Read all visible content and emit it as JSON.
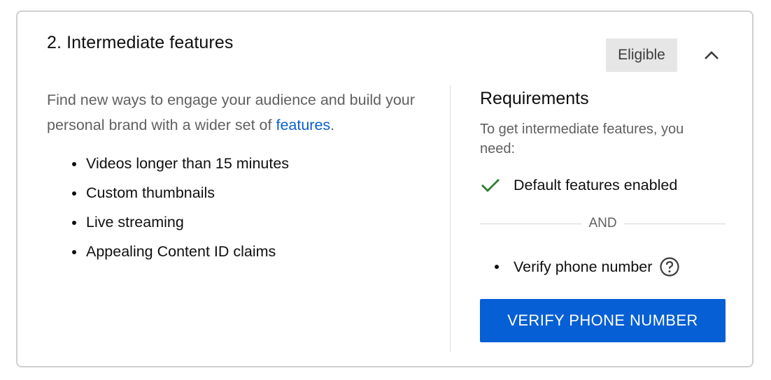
{
  "card": {
    "title": "2. Intermediate features",
    "status_badge": "Eligible",
    "collapse_icon": "chevron-up-icon"
  },
  "left": {
    "description_prefix": "Find new ways to engage your audience and build your personal brand with a wider set of ",
    "description_link": "features",
    "description_suffix": ".",
    "features": [
      "Videos longer than 15 minutes",
      "Custom thumbnails",
      "Live streaming",
      "Appealing Content ID claims"
    ]
  },
  "requirements": {
    "title": "Requirements",
    "subtitle": "To get intermediate features, you need:",
    "completed": {
      "icon": "checkmark-icon",
      "label": "Default features enabled"
    },
    "separator": "AND",
    "pending": {
      "label": "Verify phone number",
      "help_icon": "help-circle-icon"
    },
    "button_label": "VERIFY PHONE NUMBER"
  },
  "colors": {
    "accent": "#065fd4",
    "check": "#2e7d32",
    "badge_bg": "#e6e6e6"
  }
}
